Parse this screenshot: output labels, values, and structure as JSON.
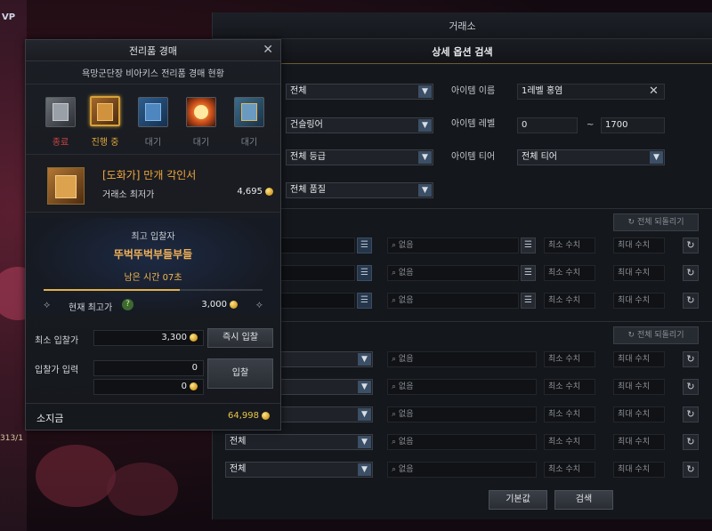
{
  "background": {
    "accent": "#5a1f2c"
  },
  "market": {
    "title": "거래소",
    "subtitle": "상세 옵션 검색",
    "left_selects": [
      "전체",
      "건슬링어",
      "전체 등급",
      "전체 품질"
    ],
    "item_name_label": "아이템 이름",
    "item_name_value": "1레벨 홍염",
    "item_level_label": "아이템 레벨",
    "level_min": "0",
    "level_tilde": "~",
    "level_max": "1700",
    "item_tier_label": "아이템 티어",
    "item_tier_value": "전체 티어",
    "reset_all_label": "전체 되돌리기",
    "engrave_rows": [
      {
        "option": "없음",
        "min": "최소 수치",
        "max": "최대 수치"
      },
      {
        "option": "없음",
        "min": "최소 수치",
        "max": "최대 수치"
      },
      {
        "option": "없음",
        "min": "최소 수치",
        "max": "최대 수치"
      }
    ],
    "stat_rows": [
      {
        "select": "",
        "option": "없음",
        "min": "최소 수치",
        "max": "최대 수치"
      },
      {
        "select": "",
        "option": "없음",
        "min": "최소 수치",
        "max": "최대 수치"
      },
      {
        "select": "",
        "option": "없음",
        "min": "최소 수치",
        "max": "최대 수치"
      },
      {
        "select": "전체",
        "option": "없음",
        "min": "최소 수치",
        "max": "최대 수치"
      },
      {
        "select": "전체",
        "option": "없음",
        "min": "최소 수치",
        "max": "최대 수치"
      }
    ],
    "default_button": "기본값",
    "search_button": "검색"
  },
  "auction": {
    "title": "전리품 경매",
    "caption": "욕망군단장 비아키스 전리품 경매 현황",
    "slots": [
      {
        "label": "종료",
        "state": "end"
      },
      {
        "label": "진행 중",
        "state": "progress"
      },
      {
        "label": "대기",
        "state": "wait"
      },
      {
        "label": "대기",
        "state": "wait"
      },
      {
        "label": "대기",
        "state": "wait"
      }
    ],
    "item_name": "[도화가] 만개 각인서",
    "market_min_label": "거래소 최저가",
    "market_min_value": "4,695",
    "top_bidder_label": "최고 입찰자",
    "top_bidder_name": "뚜벅뚜벅부들부들",
    "time_left": "남은 시간 07초",
    "time_progress": 0.62,
    "current_top_label": "현재 최고가",
    "current_top_value": "3,000",
    "min_bid_label": "최소 입찰가",
    "min_bid_value": "3,300",
    "instant_bid_button": "즉시 입찰",
    "bid_input_label": "입찰가 입력",
    "bid_input_value": "0",
    "bid_input_gold": "0",
    "bid_button": "입찰",
    "gold_label": "소지금",
    "gold_value": "64,998"
  },
  "edge": {
    "left_text": "313/1",
    "vp": "VP"
  }
}
